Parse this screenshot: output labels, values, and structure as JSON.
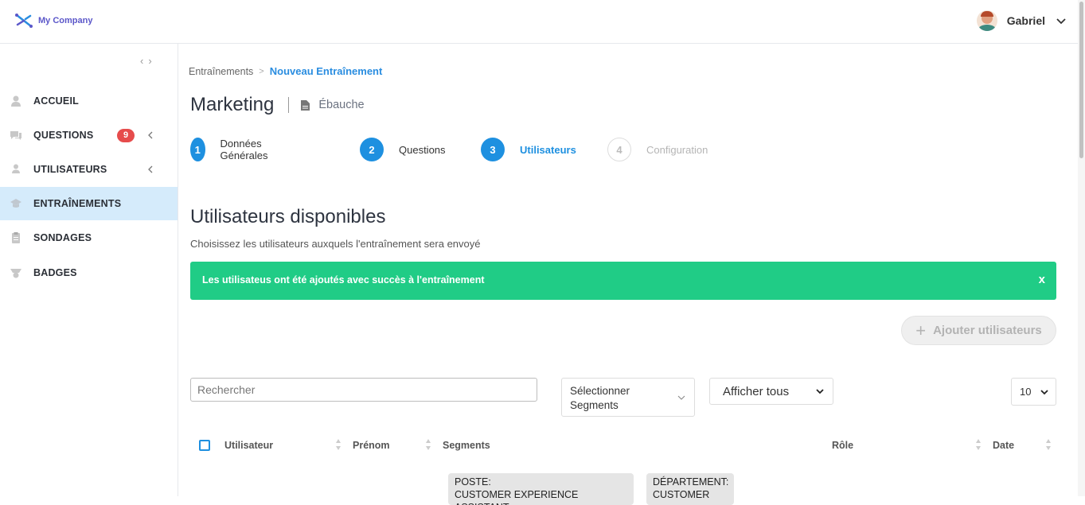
{
  "app": {
    "company_name": "My Company"
  },
  "user": {
    "name": "Gabriel"
  },
  "sidebar": {
    "items": [
      {
        "label": "ACCUEIL",
        "icon": "home-icon"
      },
      {
        "label": "QUESTIONS",
        "icon": "chat-icon",
        "badge": "9"
      },
      {
        "label": "UTILISATEURS",
        "icon": "user-icon"
      },
      {
        "label": "ENTRAÎNEMENTS",
        "icon": "graduation-cap-icon",
        "active": true
      },
      {
        "label": "SONDAGES",
        "icon": "clipboard-icon"
      },
      {
        "label": "BADGES",
        "icon": "badge-icon"
      }
    ]
  },
  "breadcrumb": {
    "parent": "Entraînements",
    "separator": ">",
    "current": "Nouveau Entraînement"
  },
  "page": {
    "title": "Marketing",
    "status": "Ébauche"
  },
  "steps": [
    {
      "number": "1",
      "label": "Données Générales"
    },
    {
      "number": "2",
      "label": "Questions"
    },
    {
      "number": "3",
      "label": "Utilisateurs",
      "current": true
    },
    {
      "number": "4",
      "label": "Configuration",
      "inactive": true
    }
  ],
  "section": {
    "title": "Utilisateurs disponibles",
    "subtitle": "Choisissez les utilisateurs auxquels l'entraînement sera envoyé"
  },
  "alert": {
    "message": "Les utilisateus ont été ajoutés avec succès à l'entraînement",
    "close_label": "x",
    "color": "#20cc86"
  },
  "actions": {
    "add_users_label": "Ajouter utilisateurs"
  },
  "filters": {
    "search_placeholder": "Rechercher",
    "segments_line1": "Sélectionner",
    "segments_line2": "Segments",
    "show_all": "Afficher tous",
    "page_size": "10"
  },
  "table": {
    "columns": [
      "Utilisateur",
      "Prénom",
      "Segments",
      "Rôle",
      "Date"
    ],
    "first_row_segments": [
      {
        "line1": "POSTE:",
        "line2": "CUSTOMER EXPERIENCE ASSISTANT"
      },
      {
        "line1": "DÉPARTEMENT:",
        "line2": "CUSTOMER"
      }
    ]
  },
  "colors": {
    "accent": "#1e90e0",
    "success": "#20cc86",
    "badge": "#e64c4c",
    "active_nav": "#d5ebfb"
  }
}
